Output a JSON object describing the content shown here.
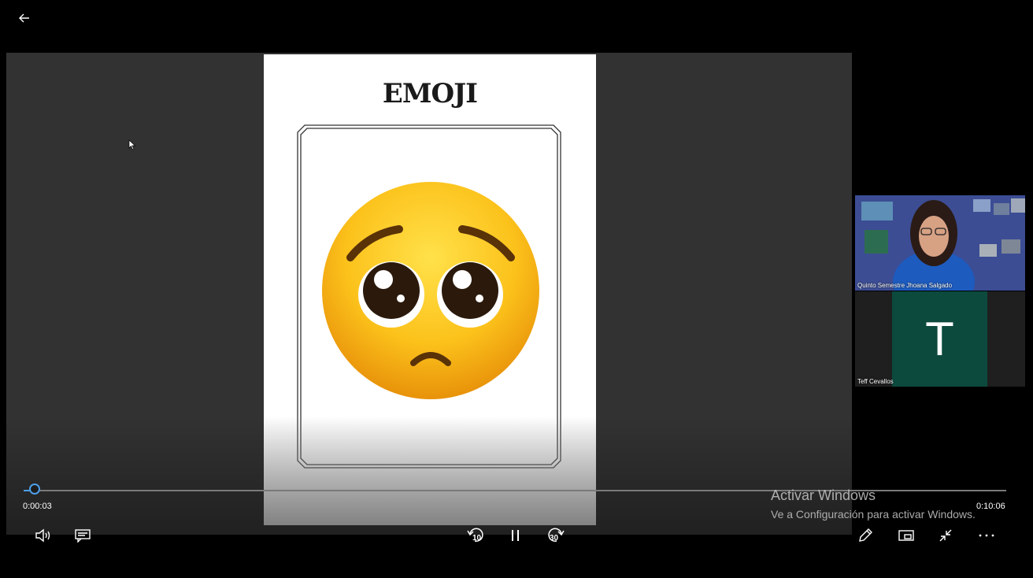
{
  "player": {
    "back_icon": "arrow-left-icon",
    "slide_title": "EMOJI",
    "emoji": "pleading-face",
    "cursor_icon": "mouse-pointer-icon"
  },
  "participants": [
    {
      "name": "Quinto Semestre Jhoana Salgado",
      "type": "video"
    },
    {
      "name": "Teff Cevallos",
      "initial": "T",
      "type": "avatar",
      "avatar_color": "#0c4a3e"
    }
  ],
  "playback": {
    "current_time": "0:00:03",
    "total_time": "0:10:06",
    "progress": 0.005,
    "accent": "#4d9ee8",
    "skip_back": "10",
    "skip_forward": "30",
    "state": "playing"
  },
  "watermark": {
    "title": "Activar Windows",
    "subtitle": "Ve a Configuración para activar Windows."
  },
  "controls": {
    "volume_icon": "volume-icon",
    "captions_icon": "captions-icon",
    "skip_back_icon": "skip-back-icon",
    "pause_icon": "pause-icon",
    "skip_forward_icon": "skip-forward-icon",
    "pen_icon": "pen-icon",
    "miniview_icon": "mini-view-icon",
    "exit_fullscreen_icon": "exit-fullscreen-icon",
    "more_icon": "more-options-icon"
  }
}
